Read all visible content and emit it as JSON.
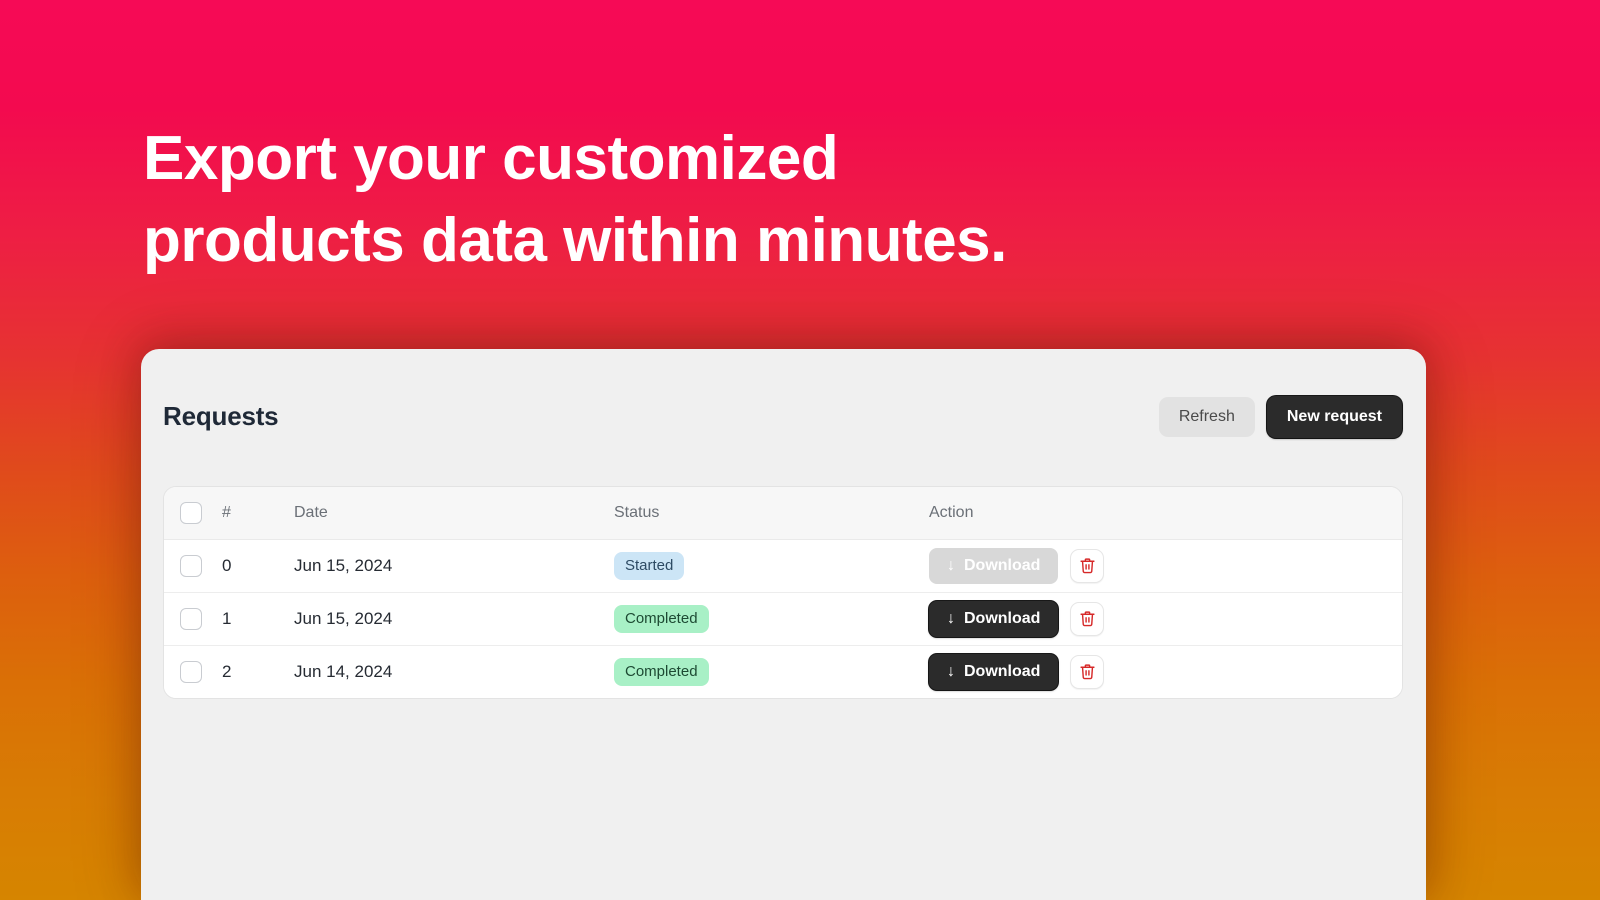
{
  "hero": {
    "line1": "Export your customized",
    "line2": "products data within minutes."
  },
  "card": {
    "title": "Requests",
    "actions": {
      "refresh_label": "Refresh",
      "new_request_label": "New request"
    },
    "table": {
      "headers": {
        "select": "",
        "number": "#",
        "date": "Date",
        "status": "Status",
        "action": "Action"
      },
      "rows": [
        {
          "number": "0",
          "date": "Jun 15, 2024",
          "status": "Started",
          "status_kind": "started",
          "download_label": "Download",
          "download_enabled": false,
          "download_icon": "download-arrow-icon",
          "delete_icon": "trash-icon"
        },
        {
          "number": "1",
          "date": "Jun 15, 2024",
          "status": "Completed",
          "status_kind": "completed",
          "download_label": "Download",
          "download_enabled": true,
          "download_icon": "download-arrow-icon",
          "delete_icon": "trash-icon"
        },
        {
          "number": "2",
          "date": "Jun 14, 2024",
          "status": "Completed",
          "status_kind": "completed",
          "download_label": "Download",
          "download_enabled": true,
          "download_icon": "download-arrow-icon",
          "delete_icon": "trash-icon"
        }
      ]
    }
  },
  "colors": {
    "gradient_top": "#f60a56",
    "gradient_bottom": "#d68500",
    "dark_button": "#2b2b2b",
    "badge_started_bg": "#cce5f6",
    "badge_completed_bg": "#a8f0c6",
    "trash_red": "#d62828",
    "card_bg": "#f0f0f0"
  }
}
